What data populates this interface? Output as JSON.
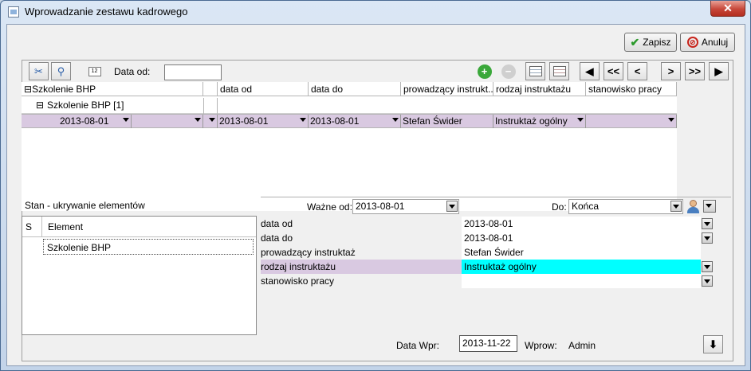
{
  "window": {
    "title": "Wprowadzanie zestawu kadrowego",
    "close": "✕"
  },
  "actions": {
    "save": "Zapisz",
    "cancel": "Anuluj"
  },
  "toolbar": {
    "date_from_label": "Data od:",
    "date_from_value": ""
  },
  "nav": {
    "first": "|<",
    "prev_fast": "<<",
    "prev": "<",
    "next": ">",
    "next_fast": ">>",
    "last": ">|"
  },
  "grid": {
    "tree": {
      "root": "Szkolenie BHP",
      "child": "Szkolenie BHP [1]",
      "row_date": "2013-08-01"
    },
    "columns": [
      "data od",
      "data do",
      "prowadzący instrukt...",
      "rodzaj instruktażu",
      "stanowisko pracy"
    ],
    "row": {
      "data_od": "2013-08-01",
      "data_do": "2013-08-01",
      "prowadzacy": "Stefan Świder",
      "rodzaj": "Instruktaż ogólny",
      "stanowisko": ""
    }
  },
  "left_panel": {
    "title": "Stan - ukrywanie elementów",
    "col_s": "S",
    "col_element": "Element",
    "item": "Szkolenie BHP"
  },
  "right_panel": {
    "valid_from_label": "Ważne od:",
    "valid_from_value": "2013-08-01",
    "to_label": "Do:",
    "to_value": "Końca",
    "props": [
      {
        "key": "data od",
        "value": "2013-08-01"
      },
      {
        "key": "data do",
        "value": "2013-08-01"
      },
      {
        "key": "prowadzący instruktaż",
        "value": "Stefan Świder"
      },
      {
        "key": "rodzaj instruktażu",
        "value": "Instruktaż ogólny"
      },
      {
        "key": "stanowisko pracy",
        "value": ""
      }
    ]
  },
  "footer": {
    "entry_date_label": "Data Wpr:",
    "entry_date_value": "2013-11-22",
    "entered_by_label": "Wprow:",
    "entered_by_value": "Admin"
  },
  "colors": {
    "selected_row": "#d9c9e1",
    "highlight_value": "#00ffff"
  }
}
